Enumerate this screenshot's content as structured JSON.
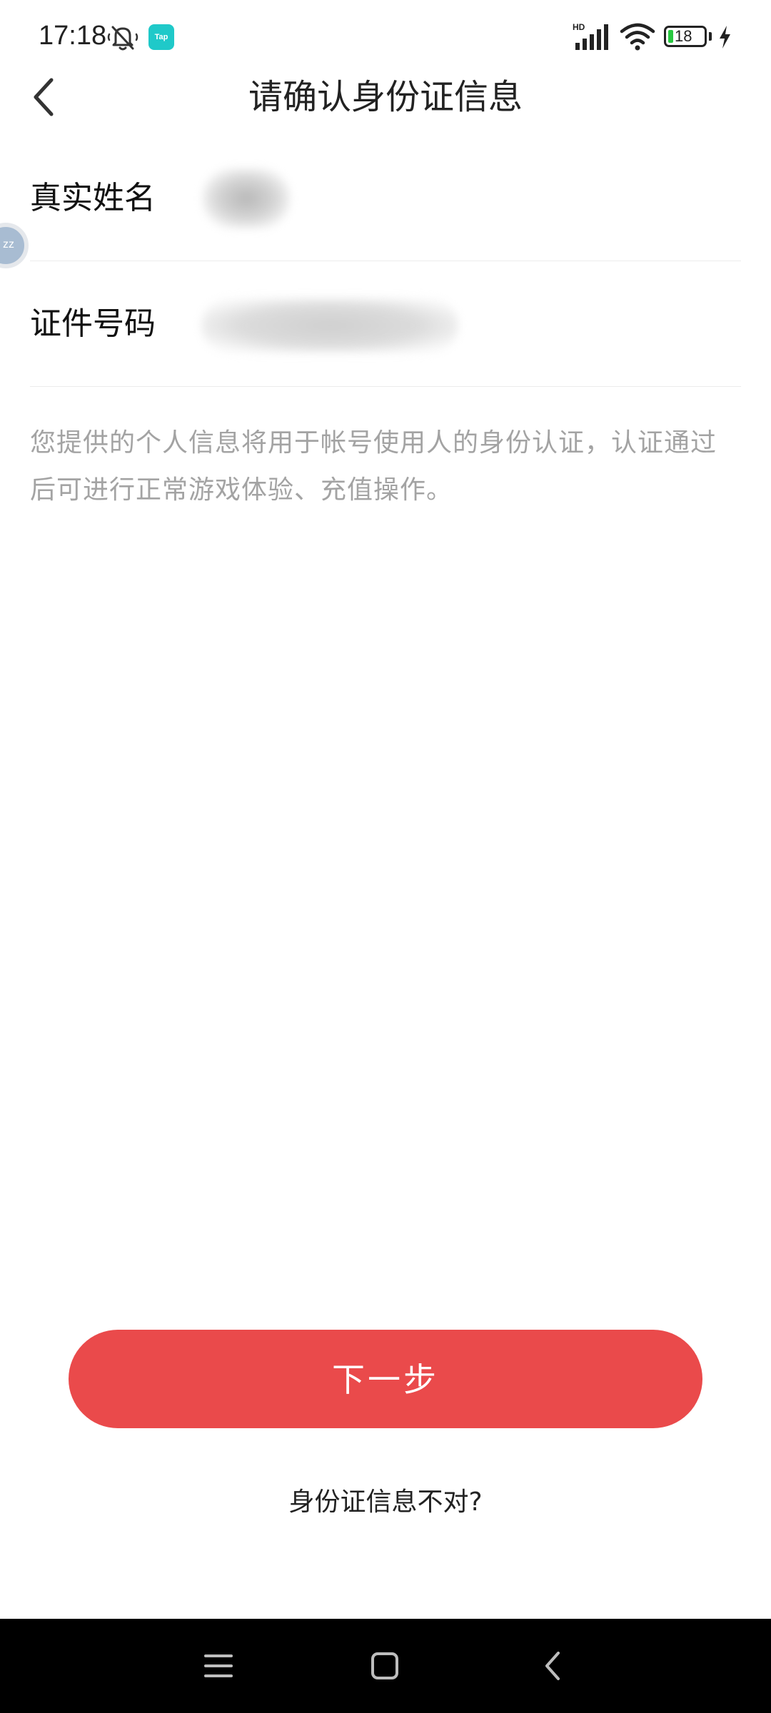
{
  "status_bar": {
    "time": "17:18",
    "app_badge": "Tap",
    "network_badge": "HD",
    "battery_level": "18"
  },
  "header": {
    "title": "请确认身份证信息"
  },
  "form": {
    "name_label": "真实姓名",
    "id_label": "证件号码"
  },
  "description": "您提供的个人信息将用于帐号使用人的身份认证，认证通过后可进行正常游戏体验、充值操作。",
  "actions": {
    "next_label": "下一步",
    "wrong_info_label": "身份证信息不对?"
  },
  "colors": {
    "primary": "#ea4a4b",
    "hint_text": "#a3a3a3",
    "nav_background": "#000000",
    "battery_fill": "#28c840"
  },
  "icons": {
    "back": "chevron-left-icon",
    "mute": "bell-off-icon",
    "signal": "cellular-signal-icon",
    "wifi": "wifi-icon",
    "charging": "lightning-icon",
    "nav_menu": "menu-icon",
    "nav_home": "home-square-icon",
    "nav_back": "back-chevron-icon"
  }
}
